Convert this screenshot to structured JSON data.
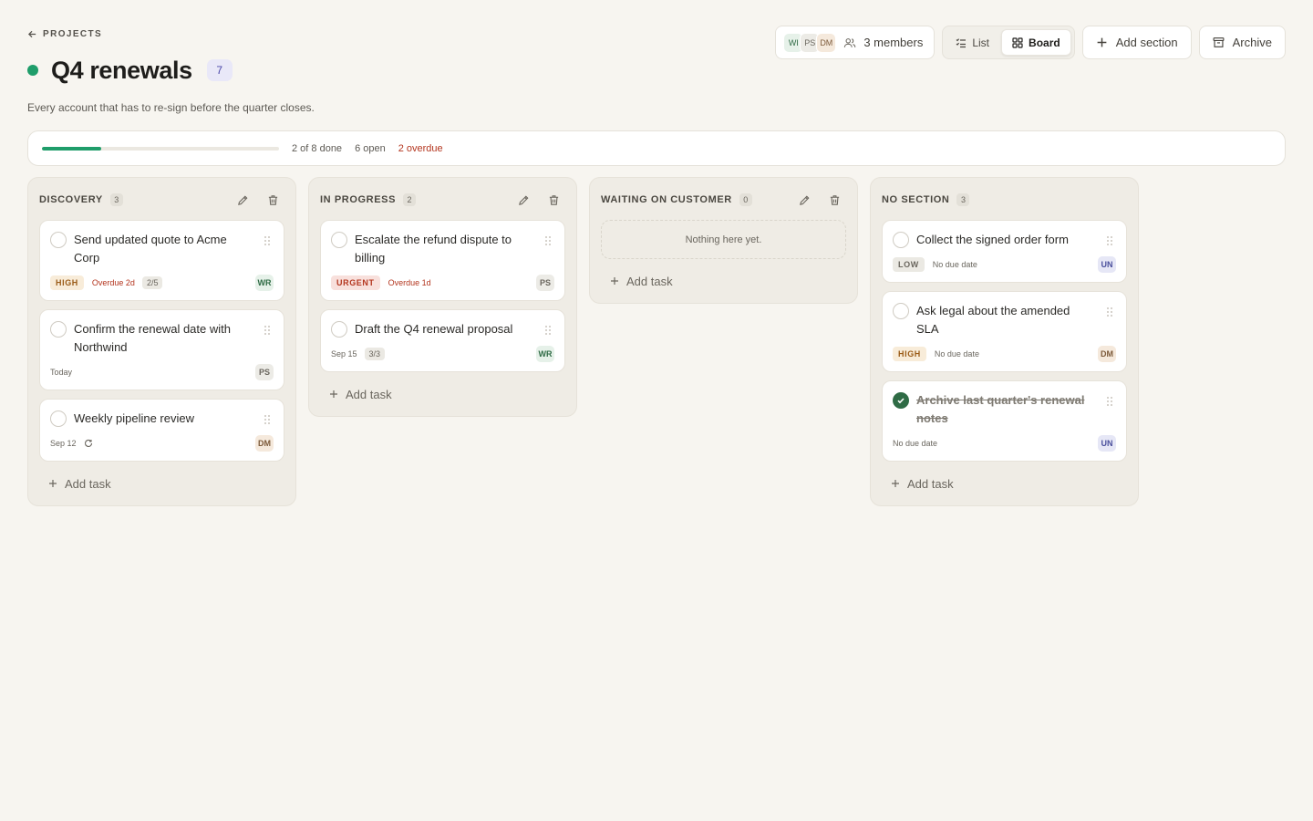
{
  "breadcrumb": {
    "label": "PROJECTS"
  },
  "project": {
    "title": "Q4 renewals",
    "task_count": "7",
    "description": "Every account that has to re-sign before the quarter closes.",
    "status_color": "#1f9d6a"
  },
  "header": {
    "avatars": [
      "WI",
      "PS",
      "DM"
    ],
    "members_label": "3 members",
    "view_list": "List",
    "view_board": "Board",
    "active_view": "Board",
    "add_section": "Add section",
    "archive": "Archive"
  },
  "progress": {
    "fraction": 0.25,
    "done_label": "2 of 8 done",
    "open_label": "6 open",
    "overdue_label": "2 overdue"
  },
  "columns": [
    {
      "name": "DISCOVERY",
      "count": "3",
      "add_label": "Add task",
      "cards": [
        {
          "title": "Send updated quote to Acme Corp",
          "priority": "HIGH",
          "due": "Overdue 2d",
          "subtasks": "2/5",
          "owner": "WR"
        },
        {
          "title": "Confirm the renewal date with Northwind",
          "due": "Today",
          "owner": "PS"
        },
        {
          "title": "Weekly pipeline review",
          "due": "Sep 12",
          "owner": "DM"
        }
      ]
    },
    {
      "name": "IN PROGRESS",
      "count": "2",
      "add_label": "Add task",
      "cards": [
        {
          "title": "Escalate the refund dispute to billing",
          "priority": "URGENT",
          "due": "Overdue 1d",
          "owner": "PS"
        },
        {
          "title": "Draft the Q4 renewal proposal",
          "due": "Sep 15",
          "subtasks": "3/3",
          "owner": "WR"
        }
      ]
    },
    {
      "name": "WAITING ON CUSTOMER",
      "count": "0",
      "empty_label": "Nothing here yet.",
      "add_label": "Add task"
    },
    {
      "name": "NO SECTION",
      "count": "3",
      "add_label": "Add task",
      "cards": [
        {
          "title": "Collect the signed order form",
          "priority": "LOW",
          "due": "No due date",
          "owner": "UN"
        },
        {
          "title": "Ask legal about the amended SLA",
          "priority": "HIGH",
          "due": "No due date",
          "owner": "DM"
        },
        {
          "title": "Archive last quarter's renewal notes",
          "due": "No due date",
          "owner": "UN",
          "done": true
        }
      ]
    }
  ]
}
